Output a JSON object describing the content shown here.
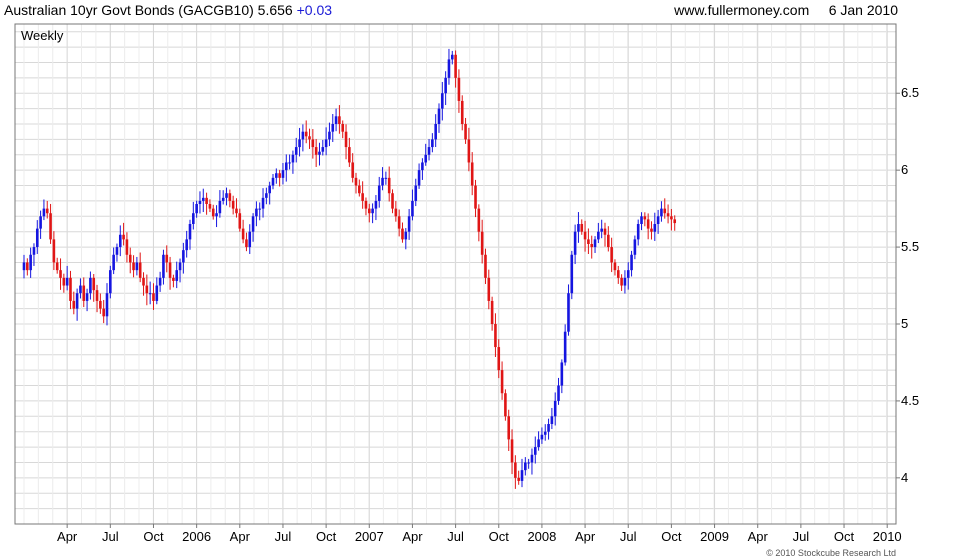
{
  "header": {
    "title": "Australian 10yr Govt Bonds (GACGB10)",
    "last": "5.656",
    "change": "+0.03",
    "site": "www.fullermoney.com",
    "date": "6 Jan 2010"
  },
  "footer": {
    "copyright": "© 2010 Stockcube Research Ltd"
  },
  "chart_data": {
    "type": "candlestick",
    "interval_label": "Weekly",
    "y_axis": {
      "ticks": [
        4,
        4.5,
        5,
        5.5,
        6,
        6.5
      ],
      "tick_labels": [
        "4",
        "4.5",
        "5",
        "5.5",
        "6",
        "6.5"
      ],
      "range": [
        3.7,
        6.95
      ],
      "side": "right"
    },
    "x_axis": {
      "tick_labels": [
        "Apr",
        "Jul",
        "Oct",
        "2006",
        "Apr",
        "Jul",
        "Oct",
        "2007",
        "Apr",
        "Jul",
        "Oct",
        "2008",
        "Apr",
        "Jul",
        "Oct",
        "2009",
        "Apr",
        "Jul",
        "Oct",
        "2010"
      ],
      "tick_index": [
        13,
        26,
        39,
        52,
        65,
        78,
        91,
        104,
        117,
        130,
        143,
        156,
        169,
        182,
        195,
        208,
        221,
        234,
        247,
        260
      ]
    },
    "grid": true,
    "colors": {
      "up": "#1515e0",
      "down": "#e01515",
      "grid": "#d8d8d8",
      "interval_label": "#1a1ad6"
    },
    "series": [
      {
        "close": [
          5.4,
          5.35,
          5.45,
          5.5,
          5.62,
          5.7,
          5.75,
          5.72,
          5.55,
          5.4,
          5.35,
          5.3,
          5.25,
          5.3,
          5.15,
          5.1,
          5.2,
          5.25,
          5.15,
          5.2,
          5.3,
          5.22,
          5.15,
          5.1,
          5.05,
          5.2,
          5.35,
          5.45,
          5.5,
          5.58,
          5.55,
          5.45,
          5.4,
          5.35,
          5.4,
          5.3,
          5.25,
          5.2,
          5.2,
          5.15,
          5.25,
          5.3,
          5.45,
          5.4,
          5.3,
          5.28,
          5.35,
          5.4,
          5.48,
          5.55,
          5.65,
          5.72,
          5.78,
          5.8,
          5.82,
          5.78,
          5.75,
          5.7,
          5.72,
          5.8,
          5.82,
          5.85,
          5.8,
          5.75,
          5.72,
          5.62,
          5.55,
          5.5,
          5.6,
          5.7,
          5.75,
          5.75,
          5.82,
          5.85,
          5.9,
          5.95,
          5.98,
          5.95,
          6.0,
          6.05,
          6.05,
          6.1,
          6.15,
          6.2,
          6.25,
          6.22,
          6.2,
          6.15,
          6.1,
          6.12,
          6.15,
          6.2,
          6.25,
          6.3,
          6.35,
          6.3,
          6.25,
          6.15,
          6.05,
          5.95,
          5.9,
          5.85,
          5.8,
          5.75,
          5.72,
          5.75,
          5.8,
          5.9,
          5.95,
          5.95,
          5.85,
          5.75,
          5.7,
          5.62,
          5.55,
          5.6,
          5.7,
          5.8,
          5.9,
          6.0,
          6.05,
          6.1,
          6.15,
          6.2,
          6.3,
          6.4,
          6.5,
          6.6,
          6.72,
          6.75,
          6.6,
          6.45,
          6.3,
          6.2,
          6.05,
          5.9,
          5.75,
          5.6,
          5.45,
          5.3,
          5.15,
          5.0,
          4.85,
          4.7,
          4.55,
          4.4,
          4.25,
          4.1,
          4.0,
          3.98,
          4.05,
          4.1,
          4.1,
          4.15,
          4.2,
          4.25,
          4.28,
          4.3,
          4.35,
          4.4,
          4.5,
          4.6,
          4.75,
          4.95,
          5.2,
          5.45,
          5.6,
          5.65,
          5.6,
          5.55,
          5.52,
          5.5,
          5.55,
          5.6,
          5.62,
          5.58,
          5.5,
          5.4,
          5.35,
          5.3,
          5.25,
          5.3,
          5.35,
          5.45,
          5.55,
          5.65,
          5.7,
          5.68,
          5.62,
          5.6,
          5.65,
          5.7,
          5.75,
          5.72,
          5.7,
          5.68,
          5.656
        ]
      }
    ]
  }
}
